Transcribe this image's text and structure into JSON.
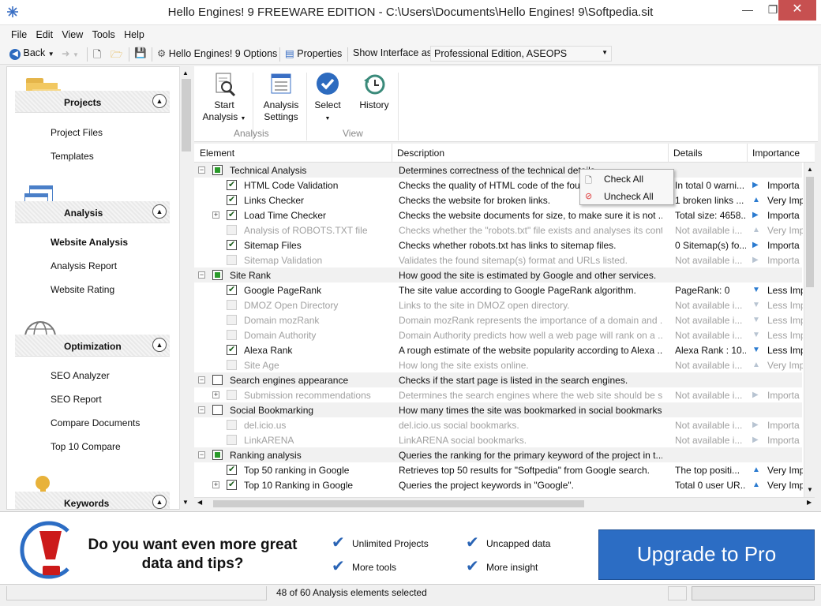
{
  "window": {
    "title": "Hello Engines! 9 FREEWARE EDITION - C:\\Users\\Documents\\Hello Engines! 9\\Softpedia.sit"
  },
  "menu": [
    "File",
    "Edit",
    "View",
    "Tools",
    "Help"
  ],
  "toolbar": {
    "back": "Back",
    "options": "Hello Engines! 9 Options",
    "properties": "Properties",
    "show_interface_label": "Show Interface as:",
    "interface_value": "Professional Edition, ASEOPS"
  },
  "sidebar": {
    "groups": [
      {
        "label": "Projects",
        "items": [
          {
            "label": "Project Files"
          },
          {
            "label": "Templates"
          }
        ]
      },
      {
        "label": "Analysis",
        "items": [
          {
            "label": "Website Analysis"
          },
          {
            "label": "Analysis Report"
          },
          {
            "label": "Website Rating"
          }
        ]
      },
      {
        "label": "Optimization",
        "items": [
          {
            "label": "SEO Analyzer"
          },
          {
            "label": "SEO Report"
          },
          {
            "label": "Compare Documents"
          },
          {
            "label": "Top 10 Compare"
          }
        ]
      },
      {
        "label": "Keywords",
        "items": []
      }
    ]
  },
  "ribbon": {
    "start": "Start",
    "analysis": "Analysis",
    "analysis2": "Analysis",
    "settings": "Settings",
    "select": "Select",
    "history": "History",
    "group_analysis": "Analysis",
    "group_view": "View"
  },
  "grid": {
    "columns": [
      "Element",
      "Description",
      "Details",
      "Importance"
    ],
    "rows": [
      {
        "group": true,
        "toggle": "−",
        "check": "sq",
        "name": "Technical Analysis",
        "desc": "Determines correctness of the technical details",
        "details": "",
        "imp": ""
      },
      {
        "check": "on",
        "name": "HTML Code Validation",
        "desc": "Checks the quality of HTML code of the four pages",
        "details": "In total 0 warni...",
        "imp": "Importa",
        "arrow": "▶"
      },
      {
        "check": "on",
        "name": "Links Checker",
        "desc": "Checks the website for broken links.",
        "details": "1 broken links ...",
        "imp": "Very Imp",
        "arrow": "▲"
      },
      {
        "check": "on",
        "toggle": "+",
        "name": "Load Time Checker",
        "desc": "Checks the website documents for size, to make sure it is not ...",
        "details": "Total size: 4658...",
        "imp": "Importa",
        "arrow": "▶"
      },
      {
        "check": "dis",
        "dim": true,
        "name": "Analysis of ROBOTS.TXT file",
        "desc": "Checks whether the \"robots.txt\" file exists and analyses its cont...",
        "details": "Not available i...",
        "imp": "Very Imp",
        "arrow": "▲"
      },
      {
        "check": "on",
        "name": "Sitemap Files",
        "desc": "Checks whether robots.txt has links to sitemap files.",
        "details": "0 Sitemap(s) fo...",
        "imp": "Importa",
        "arrow": "▶"
      },
      {
        "check": "dis",
        "dim": true,
        "name": "Sitemap Validation",
        "desc": "Validates the found sitemap(s) format and URLs listed.",
        "details": "Not available i...",
        "imp": "Importa",
        "arrow": "▶"
      },
      {
        "group": true,
        "toggle": "−",
        "check": "sq",
        "name": "Site Rank",
        "desc": "How good the site is estimated by Google and other services.",
        "details": "",
        "imp": ""
      },
      {
        "check": "on",
        "name": "Google PageRank",
        "desc": "The site value according to Google PageRank algorithm.",
        "details": "PageRank: 0",
        "imp": "Less Imp",
        "arrow": "▼"
      },
      {
        "check": "dis",
        "dim": true,
        "name": "DMOZ Open Directory",
        "desc": "Links to the site in DMOZ open directory.",
        "details": "Not available i...",
        "imp": "Less Imp",
        "arrow": "▼"
      },
      {
        "check": "dis",
        "dim": true,
        "name": "Domain mozRank",
        "desc": "Domain mozRank represents the importance of a domain and ...",
        "details": "Not available i...",
        "imp": "Less Imp",
        "arrow": "▼"
      },
      {
        "check": "dis",
        "dim": true,
        "name": "Domain Authority",
        "desc": "Domain Authority predicts how well a web page will rank on a ...",
        "details": "Not available i...",
        "imp": "Less Imp",
        "arrow": "▼"
      },
      {
        "check": "on",
        "name": "Alexa Rank",
        "desc": "A rough estimate of the website popularity according to Alexa ...",
        "details": "Alexa Rank : 10...",
        "imp": "Less Imp",
        "arrow": "▼"
      },
      {
        "check": "dis",
        "dim": true,
        "name": "Site Age",
        "desc": "How long the site exists online.",
        "details": "Not available i...",
        "imp": "Very Imp",
        "arrow": "▲"
      },
      {
        "group": true,
        "toggle": "−",
        "check": "off",
        "name": "Search engines appearance",
        "desc": "Checks if the start page is listed in the search engines.",
        "details": "",
        "imp": ""
      },
      {
        "check": "dis",
        "dim": true,
        "toggle": "+",
        "name": "Submission recommendations",
        "desc": "Determines the search engines where the web site should be s...",
        "details": "Not available i...",
        "imp": "Importa",
        "arrow": "▶"
      },
      {
        "group": true,
        "toggle": "−",
        "check": "off",
        "name": "Social Bookmarking",
        "desc": "How many times the site was bookmarked in social bookmarks.",
        "details": "",
        "imp": ""
      },
      {
        "check": "dis",
        "dim": true,
        "name": "del.icio.us",
        "desc": "del.icio.us social bookmarks.",
        "details": "Not available i...",
        "imp": "Importa",
        "arrow": "▶"
      },
      {
        "check": "dis",
        "dim": true,
        "name": "LinkARENA",
        "desc": "LinkARENA social bookmarks.",
        "details": "Not available i...",
        "imp": "Importa",
        "arrow": "▶"
      },
      {
        "group": true,
        "toggle": "−",
        "check": "sq",
        "name": "Ranking analysis",
        "desc": "Queries the ranking for the primary keyword of the project in t...",
        "details": "",
        "imp": ""
      },
      {
        "check": "on",
        "name": "Top 50 ranking in Google",
        "desc": "Retrieves top 50 results for \"Softpedia\" from Google search.",
        "details": "The top positi...",
        "imp": "Very Imp",
        "arrow": "▲"
      },
      {
        "check": "on",
        "toggle": "+",
        "name": "Top 10 Ranking in Google",
        "desc": "Queries the project keywords in \"Google\".",
        "details": "Total 0 user UR...",
        "imp": "Very Imp",
        "arrow": "▲"
      }
    ]
  },
  "context_menu": {
    "check_all": "Check All",
    "uncheck_all": "Uncheck All"
  },
  "banner": {
    "question": "Do you want even more great data and tips?",
    "features": [
      "Unlimited Projects",
      "Uncapped data",
      "More tools",
      "More insight"
    ],
    "upgrade": "Upgrade to Pro"
  },
  "status": {
    "text": "48 of 60 Analysis elements selected"
  }
}
